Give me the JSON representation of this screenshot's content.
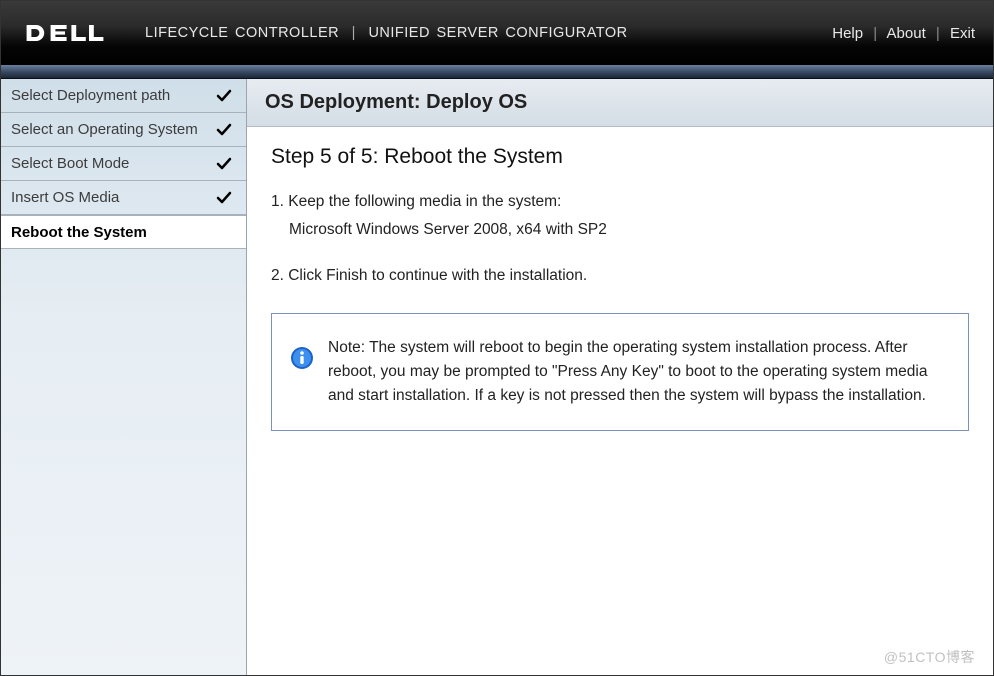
{
  "header": {
    "brand": "DELL",
    "breadcrumb_a": "LIFECYCLE CONTROLLER",
    "breadcrumb_b": "UNIFIED SERVER CONFIGURATOR",
    "nav": {
      "help": "Help",
      "about": "About",
      "exit": "Exit"
    }
  },
  "sidebar": {
    "items": [
      {
        "label": "Select Deployment path",
        "done": true,
        "active": false
      },
      {
        "label": "Select an Operating System",
        "done": true,
        "active": false
      },
      {
        "label": "Select Boot Mode",
        "done": true,
        "active": false
      },
      {
        "label": "Insert OS Media",
        "done": true,
        "active": false
      },
      {
        "label": "Reboot the System",
        "done": false,
        "active": true
      }
    ]
  },
  "main": {
    "title": "OS Deployment: Deploy OS",
    "step": "Step 5 of 5: Reboot the System",
    "line1": "1. Keep the following media in the system:",
    "media": "Microsoft Windows Server 2008, x64 with SP2",
    "line2": "2. Click Finish to continue with the installation.",
    "note": "Note: The system will reboot to begin the operating system installation process. After reboot, you may be prompted to \"Press Any Key\" to boot to the operating system media and start installation. If a key is not pressed then the system will bypass the installation."
  },
  "watermark": "@51CTO博客"
}
